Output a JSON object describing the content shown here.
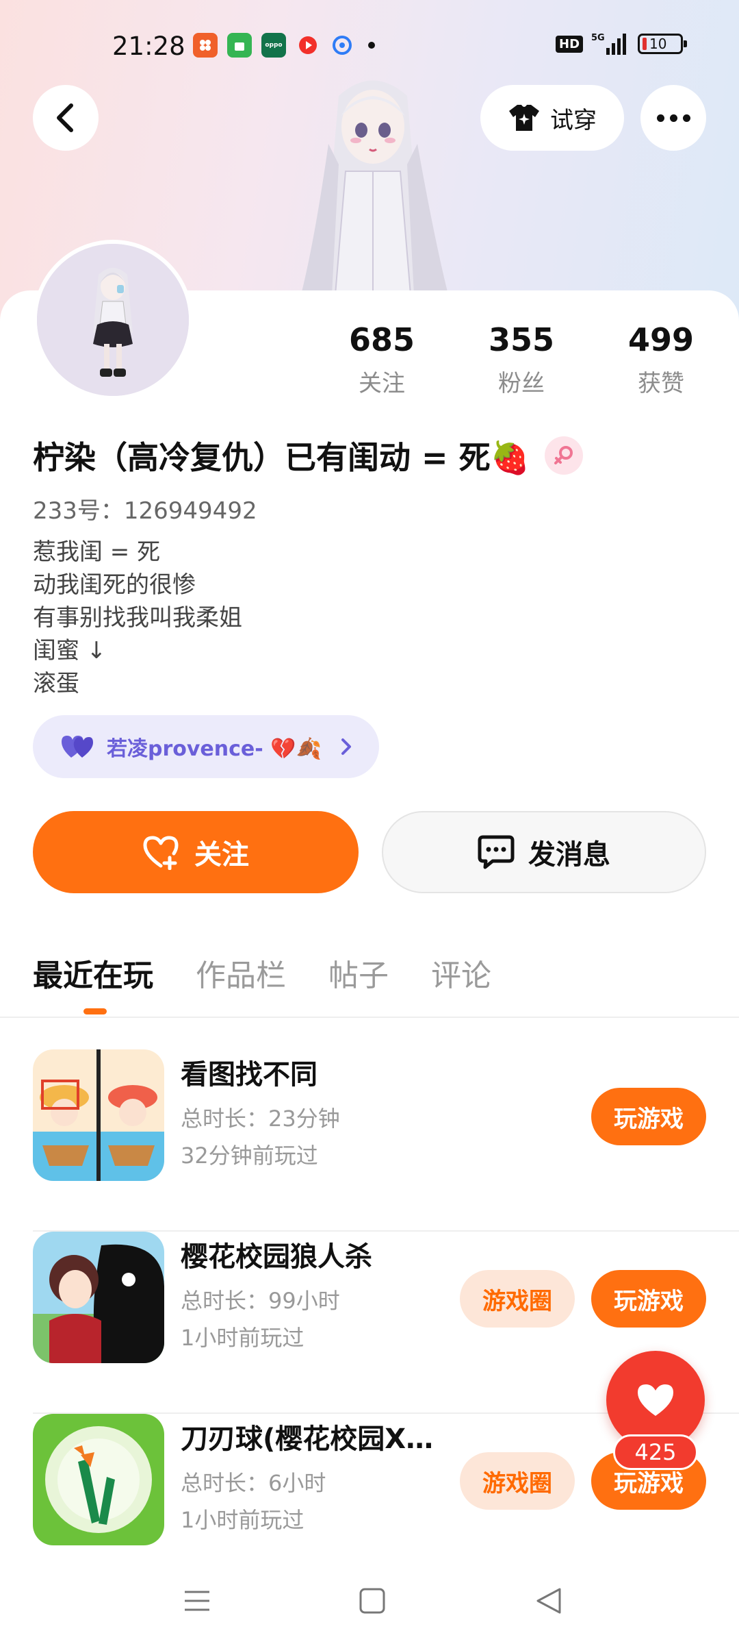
{
  "status_bar": {
    "time": "21:28",
    "hd": "HD",
    "network": "5G",
    "battery": "10"
  },
  "header": {
    "tryon_label": "试穿"
  },
  "stats": [
    {
      "value": "685",
      "label": "关注"
    },
    {
      "value": "355",
      "label": "粉丝"
    },
    {
      "value": "499",
      "label": "获赞"
    }
  ],
  "profile": {
    "name": "柠染（高冷复仇）已有闺动 = 死🍓",
    "uid": "233号：126949492",
    "bio": [
      "惹我闺 = 死",
      "动我闺死的很惨",
      "有事别找我叫我柔姐",
      "闺蜜 ↓",
      "滚蛋"
    ],
    "bestie": "若凌provence- 💔🍂"
  },
  "actions": {
    "follow": "关注",
    "message": "发消息"
  },
  "tabs": [
    "最近在玩",
    "作品栏",
    "帖子",
    "评论"
  ],
  "games": [
    {
      "title": "看图找不同",
      "duration": "总时长：23分钟",
      "last_played": "32分钟前玩过",
      "play": "玩游戏",
      "circle": ""
    },
    {
      "title": "樱花校园狼人杀",
      "duration": "总时长：99小时",
      "last_played": "1小时前玩过",
      "play": "玩游戏",
      "circle": "游戏圈"
    },
    {
      "title": "刀刃球(樱花校园X…",
      "duration": "总时长：6小时",
      "last_played": "1小时前玩过",
      "play": "玩游戏",
      "circle": "游戏圈"
    }
  ],
  "like_count": "425",
  "colors": {
    "accent": "#ff7011",
    "like": "#f23b2e",
    "bestie_text": "#6a5fd9"
  }
}
